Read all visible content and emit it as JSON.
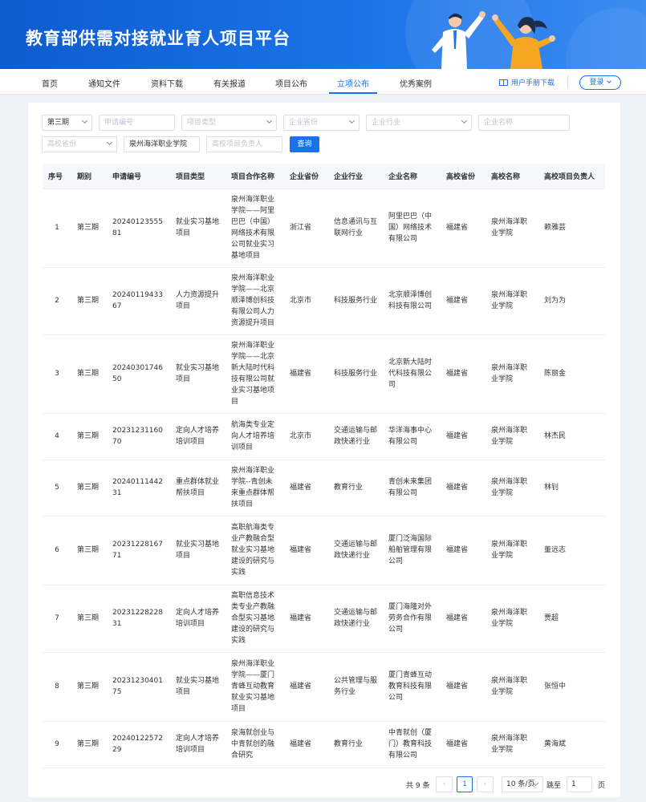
{
  "header": {
    "title": "教育部供需对接就业育人项目平台"
  },
  "nav": {
    "items": [
      "首页",
      "通知文件",
      "资料下载",
      "有关报道",
      "项目公布",
      "立项公布",
      "优秀案例"
    ],
    "active_index": 5,
    "manual_label": "用户手册下载",
    "login_label": "登录"
  },
  "filters": {
    "period": "第三期",
    "application_no_placeholder": "申请编号",
    "project_type_placeholder": "项目类型",
    "company_province_placeholder": "企业省份",
    "company_industry_placeholder": "企业行业",
    "company_name_placeholder": "企业名称",
    "school_province_placeholder": "高校省份",
    "school_name": "泉州海洋职业学院",
    "school_leader_placeholder": "高校项目负责人",
    "query_label": "查询"
  },
  "table": {
    "headers": [
      "序号",
      "期别",
      "申请编号",
      "项目类型",
      "项目合作名称",
      "企业省份",
      "企业行业",
      "企业名称",
      "高校省份",
      "高校名称",
      "高校项目负责人"
    ],
    "rows": [
      [
        "1",
        "第三期",
        "2024012355581",
        "就业实习基地项目",
        "泉州海洋职业学院——阿里巴巴（中国）网络技术有限公司就业实习基地项目",
        "浙江省",
        "信息通讯与互联网行业",
        "阿里巴巴（中国）网络技术有限公司",
        "福建省",
        "泉州海洋职业学院",
        "赖雅芸"
      ],
      [
        "2",
        "第三期",
        "2024011943367",
        "人力资源提升项目",
        "泉州海洋职业学院——北京顺泽博创科技有限公司人力资源提升项目",
        "北京市",
        "科技服务行业",
        "北京顺泽博创科技有限公司",
        "福建省",
        "泉州海洋职业学院",
        "刘为为"
      ],
      [
        "3",
        "第三期",
        "2024030174650",
        "就业实习基地项目",
        "泉州海洋职业学院——北京新大陆时代科技有限公司就业实习基地项目",
        "福建省",
        "科技服务行业",
        "北京新大陆时代科技有限公司",
        "福建省",
        "泉州海洋职业学院",
        "陈丽金"
      ],
      [
        "4",
        "第三期",
        "2023123116070",
        "定向人才培养培训项目",
        "航海类专业定向人才培养培训项目",
        "北京市",
        "交通运输与邮政快递行业",
        "华洋海事中心有限公司",
        "福建省",
        "泉州海洋职业学院",
        "林杰民"
      ],
      [
        "5",
        "第三期",
        "2024011144231",
        "重点群体就业帮扶项目",
        "泉州海洋职业学院--青创未来重点群体帮扶项目",
        "福建省",
        "教育行业",
        "青创未来集团有限公司",
        "福建省",
        "泉州海洋职业学院",
        "林钊"
      ],
      [
        "6",
        "第三期",
        "2023122816771",
        "就业实习基地项目",
        "高职航海类专业产教融合型就业实习基地建设的研究与实践",
        "福建省",
        "交通运输与邮政快递行业",
        "厦门泛海国际船舶管理有限公司",
        "福建省",
        "泉州海洋职业学院",
        "董远志"
      ],
      [
        "7",
        "第三期",
        "2023122822831",
        "定向人才培养培训项目",
        "高职信息技术类专业产教融合型实习基地建设的研究与实践",
        "福建省",
        "交通运输与邮政快递行业",
        "厦门海隆对外劳务合作有限公司",
        "福建省",
        "泉州海洋职业学院",
        "贾超"
      ],
      [
        "8",
        "第三期",
        "2023123040175",
        "就业实习基地项目",
        "泉州海洋职业学院——厦门青蜂互动教育就业实习基地项目",
        "福建省",
        "公共管理与服务行业",
        "厦门青蜂互动教育科技有限公司",
        "福建省",
        "泉州海洋职业学院",
        "张恒中"
      ],
      [
        "9",
        "第三期",
        "2024012257229",
        "定向人才培养培训项目",
        "泉海就创业与中青就创的融合研究",
        "福建省",
        "教育行业",
        "中青就创（厦门）教育科技有限公司",
        "福建省",
        "泉州海洋职业学院",
        "黄海斌"
      ]
    ]
  },
  "pagination": {
    "total_label": "共 9 条",
    "current_page": "1",
    "page_size": "10 条/页",
    "goto_label": "跳至",
    "goto_value": "1",
    "page_suffix": "页",
    "prev_icon": "‹",
    "next_icon": "›"
  }
}
